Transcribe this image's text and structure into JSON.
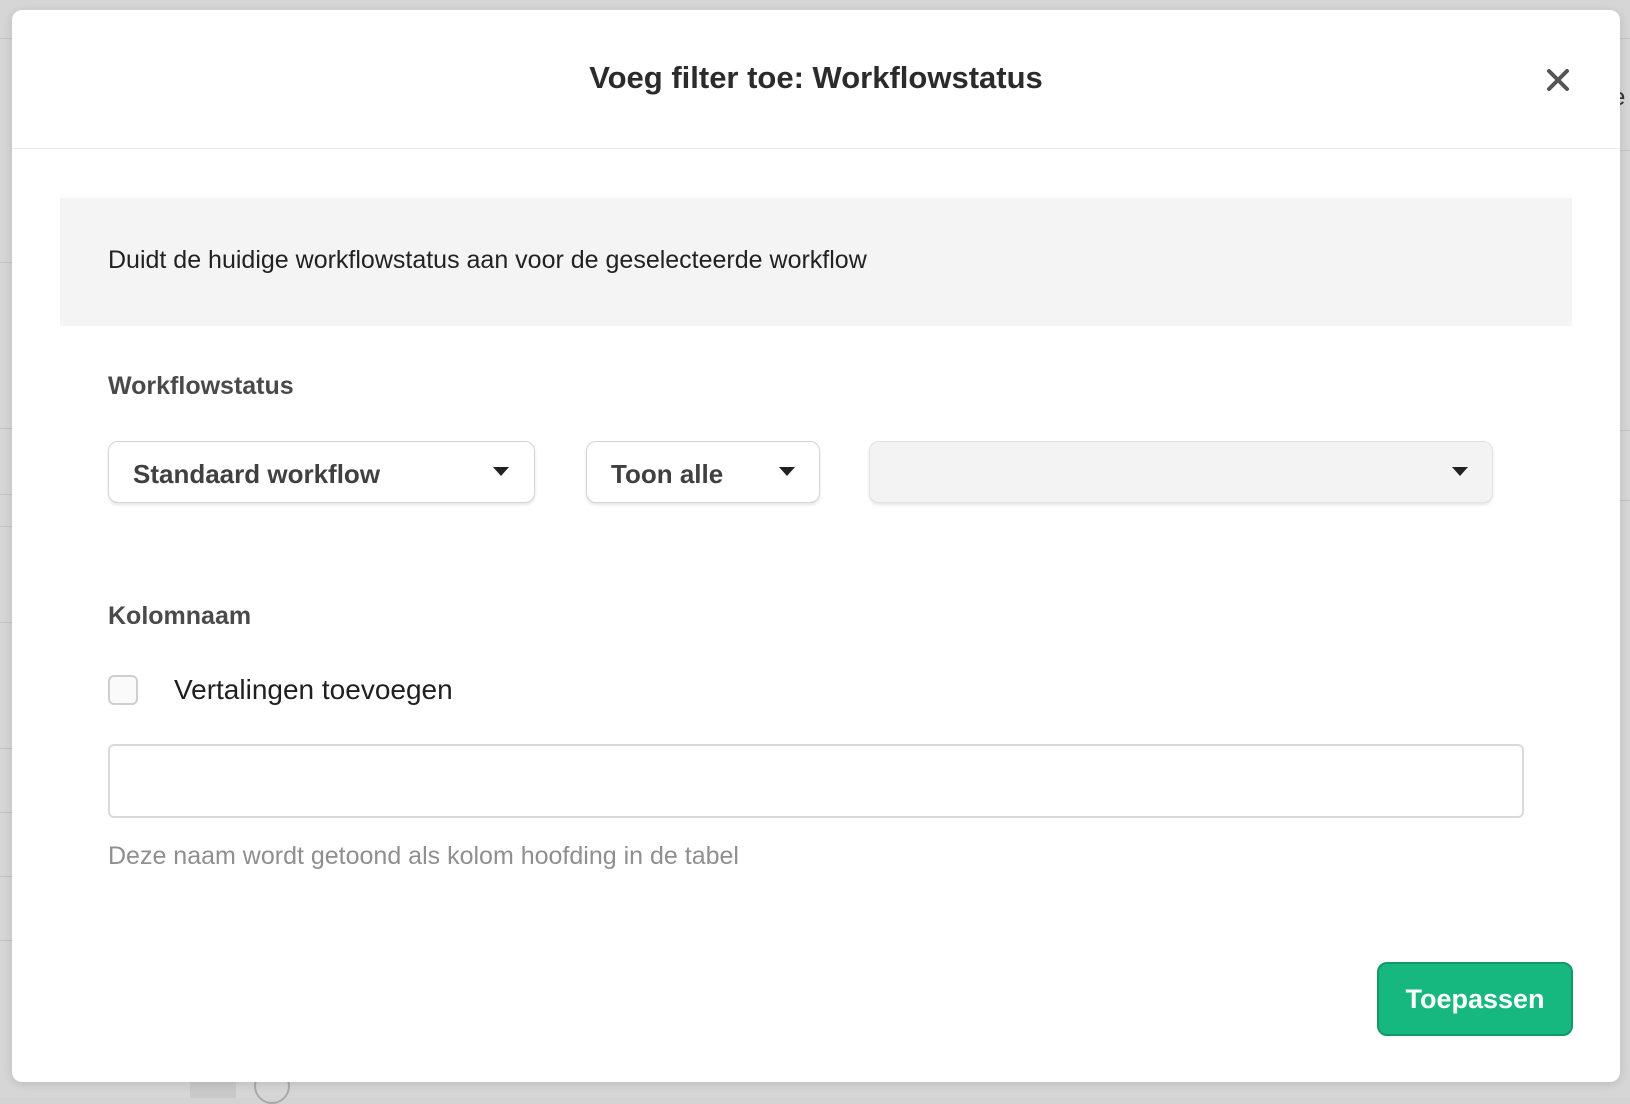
{
  "modal": {
    "title": "Voeg filter toe: Workflowstatus",
    "close_icon": "close-icon",
    "info_text": "Duidt de huidige workflowstatus aan voor de geselecteerde workflow",
    "workflow_section": {
      "label": "Workflowstatus",
      "workflow_select": {
        "value": "Standaard workflow",
        "icon": "caret-down-icon"
      },
      "scope_select": {
        "value": "Toon alle",
        "icon": "caret-down-icon"
      },
      "status_select": {
        "value": "",
        "disabled": true,
        "icon": "caret-down-icon"
      }
    },
    "column_section": {
      "label": "Kolomnaam",
      "translations_checkbox": {
        "label": "Vertalingen toevoegen",
        "checked": false
      },
      "name_input": {
        "value": "",
        "placeholder": ""
      },
      "helper_text": "Deze naam wordt getoond als kolom hoofding in de tabel"
    },
    "apply_button": {
      "label": "Toepassen",
      "color": "#17b87f"
    }
  },
  "background": {
    "peek_text": "e"
  },
  "colors": {
    "overlay": "#d3d3d3",
    "modal_bg": "#ffffff",
    "info_bg": "#f4f4f4",
    "primary": "#17b87f",
    "helper_text": "#8f8f8f"
  }
}
